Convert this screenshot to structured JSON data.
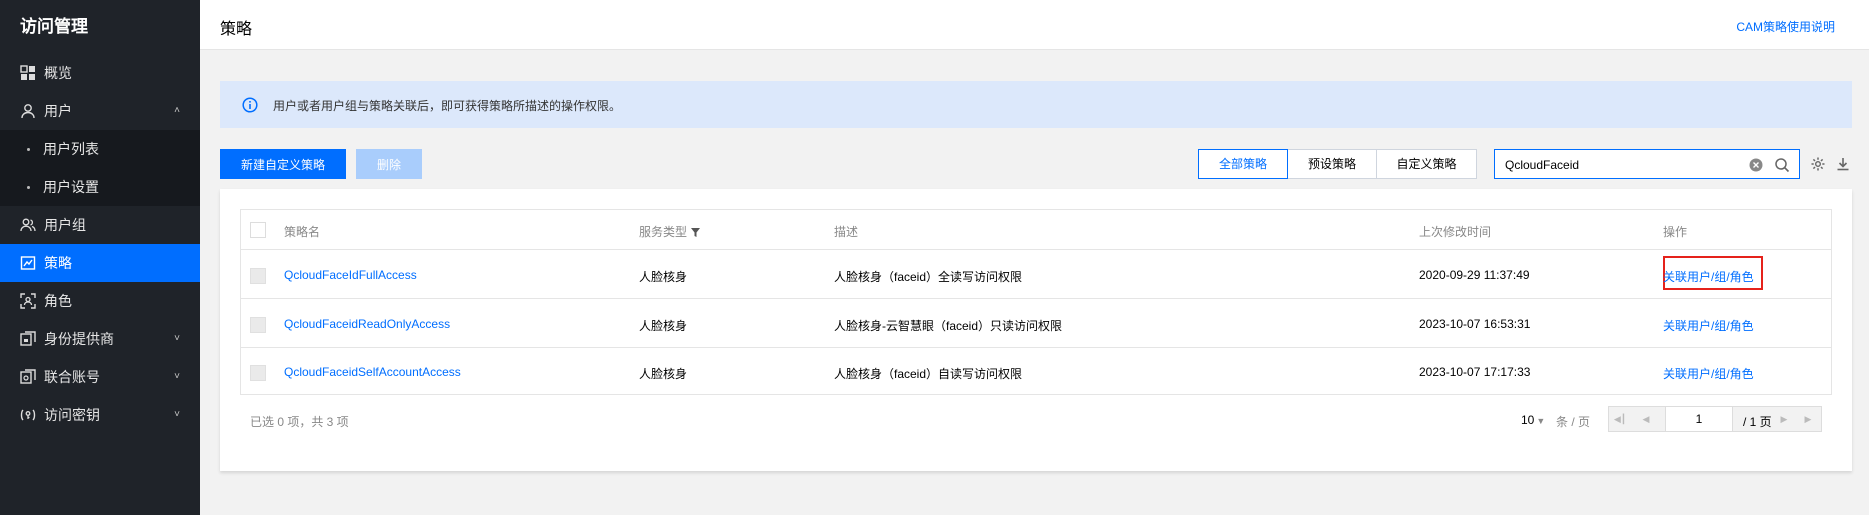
{
  "sidebar": {
    "title": "访问管理",
    "items": [
      {
        "label": "概览"
      },
      {
        "label": "用户"
      },
      {
        "label": "用户组"
      },
      {
        "label": "策略"
      },
      {
        "label": "角色"
      },
      {
        "label": "身份提供商"
      },
      {
        "label": "联合账号"
      },
      {
        "label": "访问密钥"
      }
    ],
    "sub_items": [
      {
        "label": "用户列表"
      },
      {
        "label": "用户设置"
      }
    ],
    "active_item": "策略"
  },
  "header": {
    "title": "策略",
    "help_link": "CAM策略使用说明"
  },
  "banner": {
    "text": "用户或者用户组与策略关联后，即可获得策略所描述的操作权限。"
  },
  "toolbar": {
    "create_label": "新建自定义策略",
    "delete_label": "删除",
    "segments": [
      {
        "label": "全部策略",
        "active": true
      },
      {
        "label": "预设策略",
        "active": false
      },
      {
        "label": "自定义策略",
        "active": false
      }
    ],
    "search_value": "QcloudFaceid"
  },
  "table": {
    "columns": [
      "策略名",
      "服务类型",
      "描述",
      "上次修改时间",
      "操作"
    ],
    "rows": [
      {
        "name": "QcloudFaceIdFullAccess",
        "service": "人脸核身",
        "description": "人脸核身（faceid）全读写访问权限",
        "modified": "2020-09-29 11:37:49",
        "action": "关联用户/组/角色"
      },
      {
        "name": "QcloudFaceidReadOnlyAccess",
        "service": "人脸核身",
        "description": "人脸核身-云智慧眼（faceid）只读访问权限",
        "modified": "2023-10-07 16:53:31",
        "action": "关联用户/组/角色"
      },
      {
        "name": "QcloudFaceidSelfAccountAccess",
        "service": "人脸核身",
        "description": "人脸核身（faceid）自读写访问权限",
        "modified": "2023-10-07 17:17:33",
        "action": "关联用户/组/角色"
      }
    ]
  },
  "footer": {
    "selection_summary": "已选 0 项，共 3 项",
    "page_size": "10",
    "page_size_unit": "条 / 页",
    "current_page": "1",
    "total_pages": "/ 1 页"
  },
  "colors": {
    "accent": "#006eff",
    "sidebar_bg": "#1f2329",
    "highlight_border": "#e5221b"
  }
}
